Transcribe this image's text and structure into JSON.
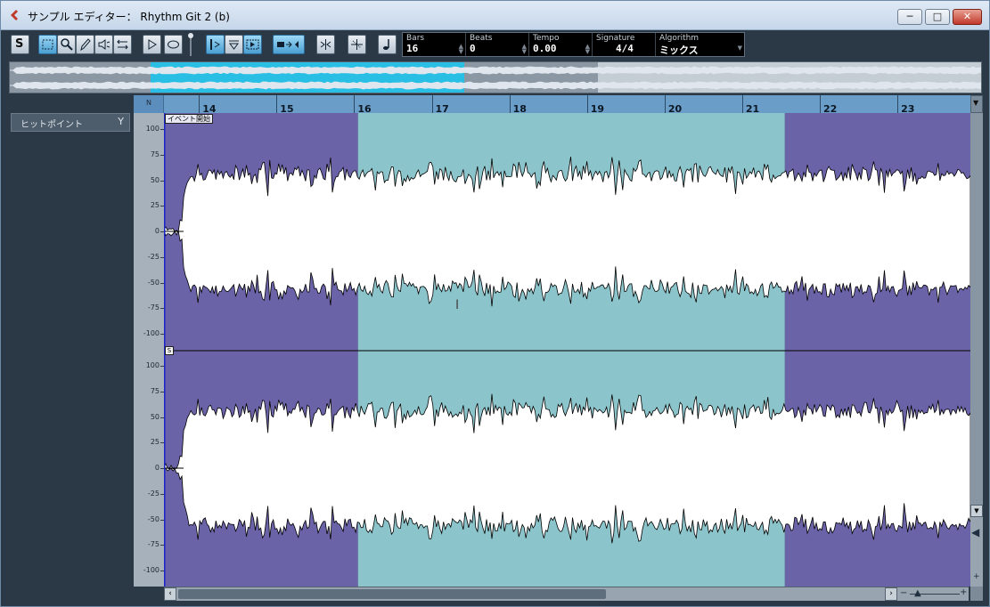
{
  "window": {
    "title": "サンプル エディター： Rhythm Git 2 (b)",
    "controls": {
      "minimize": "─",
      "maximize": "□",
      "close": "✕"
    }
  },
  "toolbar": {
    "solo_label": "S",
    "tools": [
      {
        "name": "range-select-icon",
        "active": true
      },
      {
        "name": "zoom-icon",
        "active": false
      },
      {
        "name": "pencil-icon",
        "active": false
      },
      {
        "name": "speaker-icon",
        "active": false
      },
      {
        "name": "time-warp-icon",
        "active": false
      }
    ],
    "play_icon": "play-icon",
    "loop_icon": "loop-icon",
    "infoline": [
      {
        "label": "Bars",
        "value": "16"
      },
      {
        "label": "Beats",
        "value": "0"
      },
      {
        "label": "Tempo",
        "value": "0.00"
      },
      {
        "label": "Signature",
        "value": "4/4"
      },
      {
        "label": "Algorithm",
        "value": "ミックス"
      }
    ]
  },
  "side_panel": {
    "hitpoint_tab": "ヒットポイント",
    "hitpoint_icon": "filter-icon"
  },
  "ruler": {
    "corner_label": "N",
    "bars": [
      "14",
      "15",
      "16",
      "17",
      "18",
      "19",
      "20",
      "21",
      "22",
      "23"
    ]
  },
  "scale": {
    "levels": [
      "100",
      "75",
      "50",
      "25",
      "0",
      "-25",
      "-50",
      "-75",
      "-100"
    ]
  },
  "waveform": {
    "event_start_label": "イベント開始",
    "sync_marker_label": "S",
    "colors": {
      "outside": "#6b63a8",
      "selected": "#8bc5cb",
      "wave": "#ffffff",
      "outline": "#000000"
    },
    "selection": {
      "start_bar": 16.05,
      "end_bar": 21.55
    },
    "event_start_bar": 13.55,
    "view_start_bar": 13.55,
    "view_end_bar": 23.94
  },
  "overview": {
    "colors": {
      "bg": "#8b97a3",
      "highlight": "#29bfe4",
      "wave": "#dfe6ed"
    }
  },
  "scrollbars": {
    "left_arrow": "‹",
    "right_arrow": "›",
    "up_arrow": "▲",
    "down_arrow": "▼",
    "zoom_minus": "−",
    "zoom_plus": "+",
    "zoom_knob": "▲",
    "vzoom_knob": "◀"
  }
}
